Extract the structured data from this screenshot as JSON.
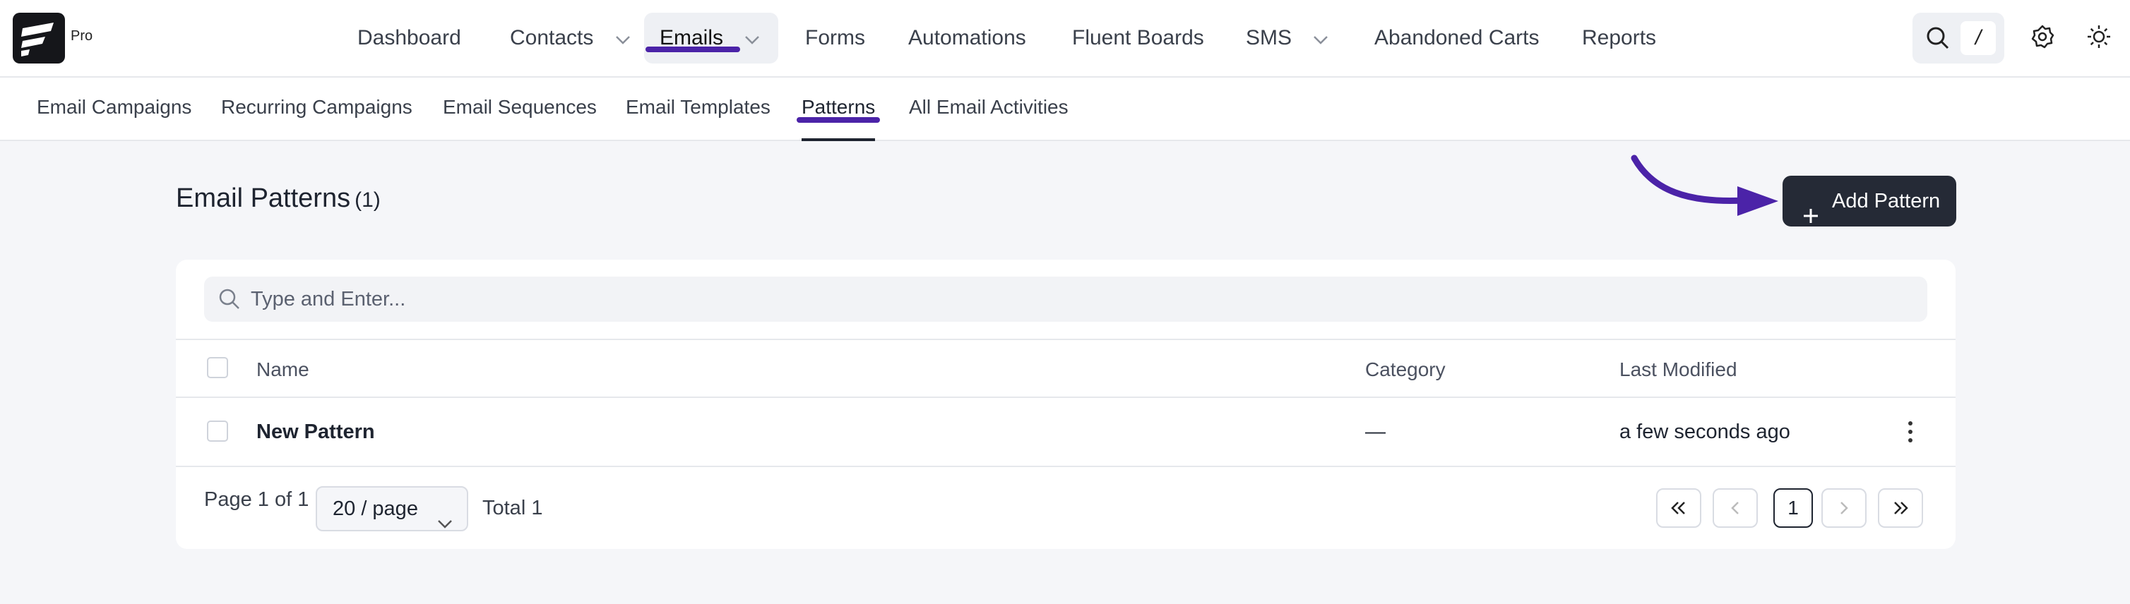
{
  "app": {
    "logo_badge": "Pro"
  },
  "main_nav": [
    {
      "label": "Dashboard",
      "has_dropdown": false
    },
    {
      "label": "Contacts",
      "has_dropdown": true
    },
    {
      "label": "Emails",
      "has_dropdown": true,
      "active": true
    },
    {
      "label": "Forms",
      "has_dropdown": false
    },
    {
      "label": "Automations",
      "has_dropdown": false
    },
    {
      "label": "Fluent Boards",
      "has_dropdown": false
    },
    {
      "label": "SMS",
      "has_dropdown": true
    },
    {
      "label": "Abandoned Carts",
      "has_dropdown": false
    },
    {
      "label": "Reports",
      "has_dropdown": false
    }
  ],
  "toolbar": {
    "search_icon": "search-icon",
    "shortcut_key": "/",
    "settings_icon": "gear-icon",
    "theme_icon": "sun-icon"
  },
  "sub_nav": [
    {
      "label": "Email Campaigns"
    },
    {
      "label": "Recurring Campaigns"
    },
    {
      "label": "Email Sequences"
    },
    {
      "label": "Email Templates"
    },
    {
      "label": "Patterns",
      "active": true
    },
    {
      "label": "All Email Activities"
    }
  ],
  "page": {
    "title": "Email Patterns",
    "count": "(1)",
    "add_button": "Add Pattern"
  },
  "search": {
    "placeholder": "Type and Enter...",
    "value": ""
  },
  "table": {
    "columns": [
      "Name",
      "Category",
      "Last Modified"
    ],
    "rows": [
      {
        "name": "New Pattern",
        "category": "—",
        "last_modified": "a few seconds ago"
      }
    ]
  },
  "pagination": {
    "page_info": "Page 1 of 1",
    "per_page": "20 / page",
    "total": "Total 1",
    "current_page": "1"
  },
  "colors": {
    "accent": "#4b23a8",
    "primary_button": "#252a36",
    "background": "#f5f6f9"
  }
}
